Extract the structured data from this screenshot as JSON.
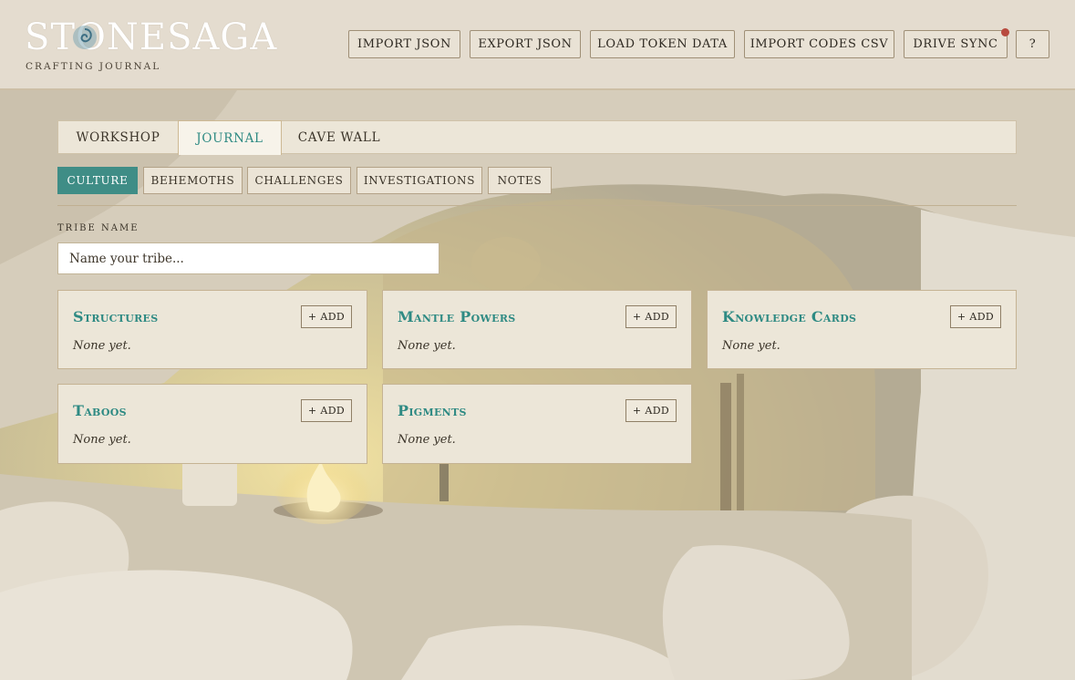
{
  "header": {
    "logo_text": "STONESAGA",
    "logo_subtitle": "CRAFTING JOURNAL",
    "buttons": [
      {
        "label": "IMPORT JSON"
      },
      {
        "label": "EXPORT JSON"
      },
      {
        "label": "LOAD TOKEN DATA"
      },
      {
        "label": "IMPORT CODES CSV"
      },
      {
        "label": "DRIVE SYNC",
        "status_dot_color": "#b84a3e"
      },
      {
        "label": "?"
      }
    ]
  },
  "main_tabs": [
    {
      "label": "WORKSHOP",
      "active": false
    },
    {
      "label": "JOURNAL",
      "active": true
    },
    {
      "label": "CAVE WALL",
      "active": false
    }
  ],
  "sub_tabs": [
    {
      "label": "CULTURE",
      "active": true
    },
    {
      "label": "BEHEMOTHS",
      "active": false
    },
    {
      "label": "CHALLENGES",
      "active": false
    },
    {
      "label": "INVESTIGATIONS",
      "active": false
    },
    {
      "label": "NOTES",
      "active": false
    }
  ],
  "tribe": {
    "label": "TRIBE NAME",
    "placeholder": "Name your tribe...",
    "value": ""
  },
  "cards": [
    {
      "title": "Structures",
      "add_label": "+ ADD",
      "empty_text": "None yet."
    },
    {
      "title": "Mantle Powers",
      "add_label": "+ ADD",
      "empty_text": "None yet."
    },
    {
      "title": "Knowledge Cards",
      "add_label": "+ ADD",
      "empty_text": "None yet."
    },
    {
      "title": "Taboos",
      "add_label": "+ ADD",
      "empty_text": "None yet."
    },
    {
      "title": "Pigments",
      "add_label": "+ ADD",
      "empty_text": "None yet."
    }
  ],
  "colors": {
    "accent": "#2e8a83",
    "active_subtab": "#3f8d86",
    "header_bg": "#e4dccf",
    "panel_bg": "#ece6d8"
  }
}
